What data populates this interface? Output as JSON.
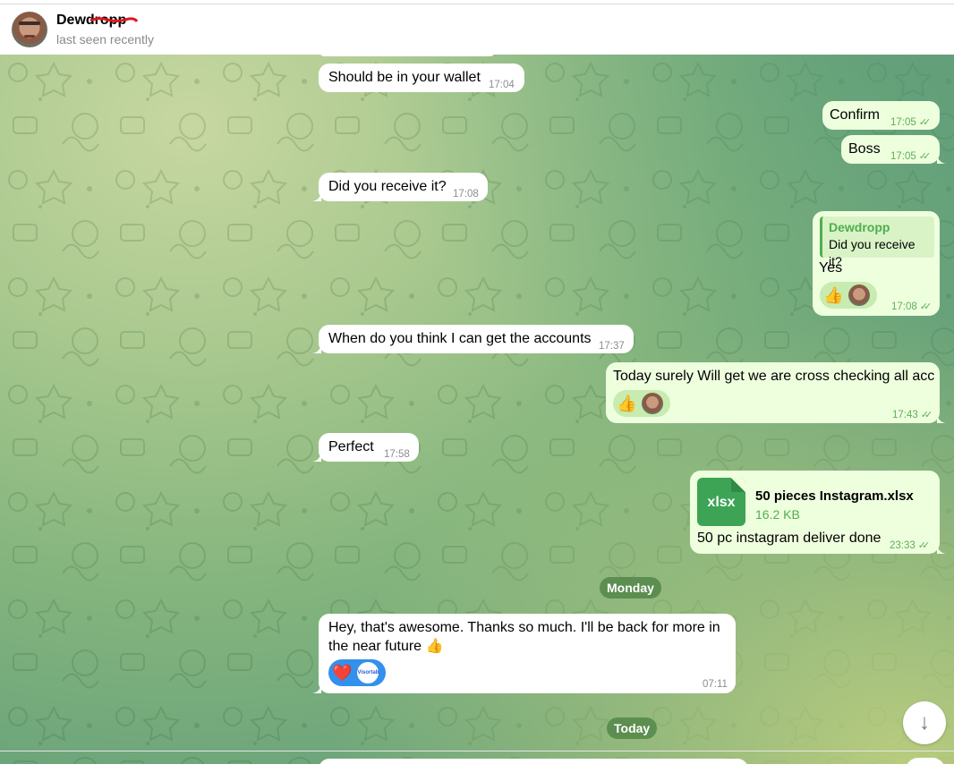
{
  "header": {
    "name": "Dewdropp",
    "status": "last seen recently"
  },
  "messages": [
    {
      "id": "m1",
      "dir": "in",
      "text": "Should be in your wallet",
      "time": "17:04"
    },
    {
      "id": "m2",
      "dir": "out",
      "text": "Confirm",
      "time": "17:05"
    },
    {
      "id": "m3",
      "dir": "out",
      "text": "Boss",
      "time": "17:05"
    },
    {
      "id": "m4",
      "dir": "in",
      "text": "Did you receive it?",
      "time": "17:08"
    },
    {
      "id": "m5",
      "dir": "out",
      "reply_name": "Dewdropp",
      "reply_text": "Did you receive it?",
      "text": "Yes",
      "time": "17:08",
      "reactions": [
        "thumbs-up",
        "avatar"
      ]
    },
    {
      "id": "m6",
      "dir": "in",
      "text": "When do you think I can get the accounts",
      "time": "17:37"
    },
    {
      "id": "m7",
      "dir": "out",
      "text": "Today surely Will get we are cross checking all acc",
      "time": "17:43",
      "reactions": [
        "thumbs-up",
        "avatar"
      ]
    },
    {
      "id": "m8",
      "dir": "in",
      "text": "Perfect",
      "time": "17:58"
    },
    {
      "id": "m9",
      "dir": "out",
      "file_ext": "xlsx",
      "file_name": "50 pieces Instagram.xlsx",
      "file_size": "16.2 KB",
      "text": "50 pc instagram deliver done",
      "time": "23:33"
    },
    {
      "id": "m10",
      "dir": "in",
      "text_line1": "Hey, that's awesome. Thanks so much. I'll be back for more in",
      "text_line2": "the near future 👍",
      "time": "07:11",
      "reactions": [
        "heart",
        "logo"
      ],
      "logo_text": "Visortab"
    }
  ],
  "day_separators": [
    "Monday",
    "Today"
  ],
  "emoji": {
    "thumbs_up": "👍",
    "heart": "❤️",
    "check": "✓✓",
    "arrow_down": "↓"
  },
  "colors": {
    "in_bubble": "#ffffff",
    "out_bubble": "#eeffde",
    "accent_green": "#4fae4e",
    "reaction_blue": "#3390ec"
  }
}
